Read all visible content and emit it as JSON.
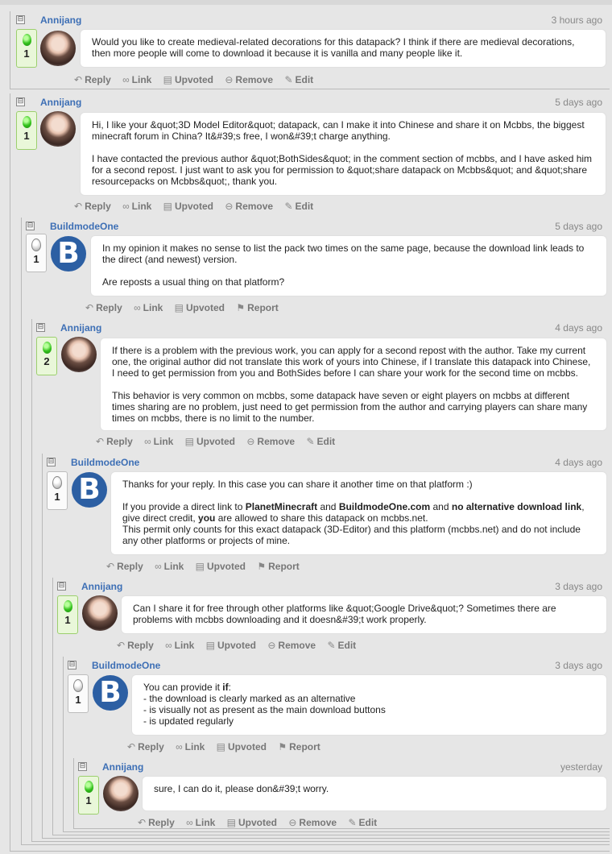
{
  "actions": {
    "reply": "Reply",
    "link": "Link",
    "upvoted": "Upvoted",
    "remove": "Remove",
    "edit": "Edit",
    "report": "Report"
  },
  "comments": [
    {
      "author": "Annijang",
      "time": "3 hours ago",
      "votes": "1",
      "body": [
        "Would you like to create medieval-related decorations for this datapack? I think if there are medieval decorations, then more people will come to download it because it is vanilla and many people like it."
      ]
    },
    {
      "author": "Annijang",
      "time": "5 days ago",
      "votes": "1",
      "body": [
        "Hi, I like your &quot;3D Model Editor&quot; datapack, can I make it into Chinese and share it on Mcbbs, the biggest minecraft forum in China? It&#39;s free, I won&#39;t charge anything.",
        "I have contacted the previous author &quot;BothSides&quot; in the comment section of mcbbs, and I have asked him for a second repost. I just want to ask you for permission to &quot;share datapack on Mcbbs&quot; and &quot;share resourcepacks on Mcbbs&quot;, thank you."
      ]
    },
    {
      "author": "BuildmodeOne",
      "time": "5 days ago",
      "votes": "1",
      "body": [
        "In my opinion it makes no sense to list the pack two times on the same page, because the download link leads to the direct (and newest) version.",
        "Are reposts a usual thing on that platform?"
      ]
    },
    {
      "author": "Annijang",
      "time": "4 days ago",
      "votes": "2",
      "body": [
        "If there is a problem with the previous work, you can apply for a second repost with the author. Take my current one, the original author did not translate this work of yours into Chinese, if I translate this datapack into Chinese, I need to get permission from you and BothSides before I can share your work for the second time on mcbbs.",
        "This behavior is very common on mcbbs, some datapack have seven or eight players on mcbbs at different times sharing are no problem, just need to get permission from the author and carrying players can share many times on mcbbs, there is no limit to the number."
      ]
    },
    {
      "author": "BuildmodeOne",
      "time": "4 days ago",
      "votes": "1",
      "body1": "Thanks for your reply. In this case you can share it another time on that platform :)",
      "body2": {
        "t1": "If you provide a direct link to ",
        "b1": "PlanetMinecraft",
        "t2": " and ",
        "b2": "BuildmodeOne.com",
        "t3": " and ",
        "b3": "no alternative download link",
        "t4": ", give direct credit, ",
        "b4": "you",
        "t5": " are allowed to share this datapack on mcbbs.net."
      },
      "body3": "This permit only counts for this exact datapack (3D-Editor) and this platform (mcbbs.net) and do not include any other platforms or projects of mine."
    },
    {
      "author": "Annijang",
      "time": "3 days ago",
      "votes": "1",
      "body": [
        "Can I share it for free through other platforms like &quot;Google Drive&quot;? Sometimes there are problems with mcbbs downloading and it doesn&#39;t work properly."
      ]
    },
    {
      "author": "BuildmodeOne",
      "time": "3 days ago",
      "votes": "1",
      "intro": "You can provide it ",
      "intro_bold": "if",
      "intro_end": ":",
      "lines": [
        "- the download is clearly marked as an alternative",
        "- is visually not as present as the main download buttons",
        "- is updated regularly"
      ]
    },
    {
      "author": "Annijang",
      "time": "yesterday",
      "votes": "1",
      "body": [
        "sure, I can do it, please don&#39;t worry."
      ]
    }
  ]
}
